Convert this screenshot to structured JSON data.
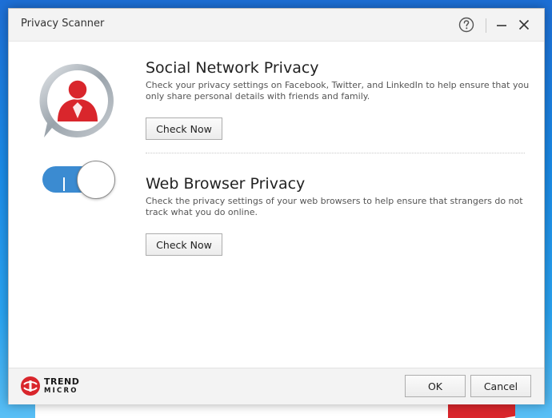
{
  "window": {
    "title": "Privacy Scanner"
  },
  "titlebar": {
    "help_icon": "question-circle-icon",
    "minimize_icon": "minimize-icon",
    "close_icon": "close-icon"
  },
  "social": {
    "icon": "social-profile-icon",
    "title": "Social Network Privacy",
    "description": "Check your privacy settings on Facebook, Twitter, and LinkedIn to help ensure that you only share personal details with friends and family.",
    "button_label": "Check Now"
  },
  "web": {
    "icon": "toggle-switch-icon",
    "title": "Web Browser Privacy",
    "description": "Check the privacy settings of your web browsers to help ensure that strangers do not track what you do online.",
    "button_label": "Check Now"
  },
  "footer": {
    "logo_line1": "TREND",
    "logo_line2": "MICRO",
    "ok_label": "OK",
    "cancel_label": "Cancel"
  },
  "colors": {
    "brand_red": "#d9262c",
    "toggle_blue": "#3b8bd1",
    "titlebar_bg": "#f3f3f3",
    "desktop_blue": "#1a8be8"
  }
}
